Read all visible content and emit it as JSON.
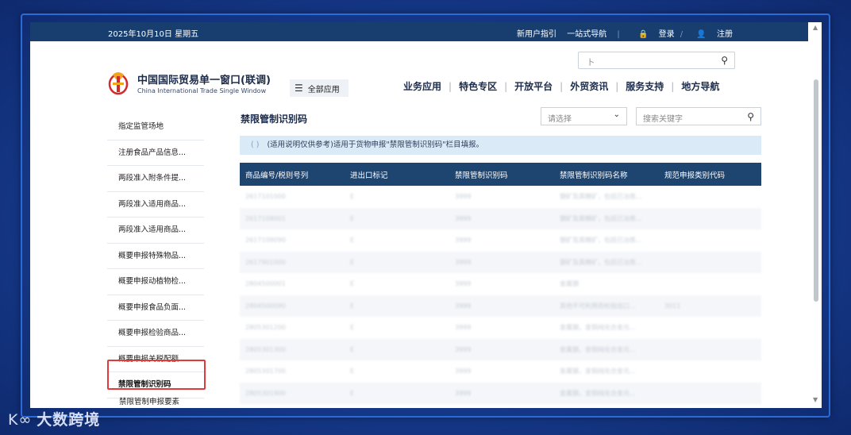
{
  "topbar": {
    "date": "2025年10月10日 星期五",
    "guide": "新用户指引",
    "one_stop": "一站式导航",
    "login": "登录",
    "register": "注册"
  },
  "header": {
    "logo_cn": "中国国际贸易单一窗口(联调)",
    "logo_en": "China International Trade Single Window",
    "all_apps": "全部应用",
    "search_placeholder": "卜",
    "nav": [
      "业务应用",
      "特色专区",
      "开放平台",
      "外贸资讯",
      "服务支持",
      "地方导航"
    ]
  },
  "sidebar": {
    "items": [
      "指定监管场地",
      "注册食品产品信息...",
      "两段准入附条件提...",
      "两段准入适用商品...",
      "两段准入适用商品...",
      "概要申报特殊物品...",
      "概要申报动植物检...",
      "概要申报食品负面...",
      "概要申报检验商品...",
      "概要申报关税配额...",
      "禁限管制识别码"
    ],
    "next_item": "禁限管制申报要素"
  },
  "main": {
    "title": "禁限管制识别码",
    "select_placeholder": "请选择",
    "keyword_placeholder": "搜索关键字",
    "notice": "(适用说明仅供参考)适用于货物申报\"禁限管制识别码\"栏目填报。",
    "table": {
      "headers": [
        "商品编号/税则号列",
        "进出口标记",
        "禁限管制识别码",
        "禁限管制识别码名称",
        "规范申报类别代码"
      ],
      "rows": [
        [
          "2617101000",
          "E",
          "3999",
          "钢矿及其精矿，包括已冶炼...",
          ""
        ],
        [
          "2617109001",
          "E",
          "3999",
          "钢矿及其精矿，包括已冶炼...",
          ""
        ],
        [
          "2617109090",
          "E",
          "3999",
          "钢矿及其精矿，包括已冶炼...",
          ""
        ],
        [
          "2617901000",
          "E",
          "3999",
          "钢矿及其精矿，包括已冶炼...",
          ""
        ],
        [
          "2804500001",
          "E",
          "3999",
          "金属钢",
          ""
        ],
        [
          "2804500090",
          "E",
          "3999",
          "其他不可利用而检验出口...",
          "3011"
        ],
        [
          "2805301200",
          "E",
          "3999",
          "金属钢，金铜纯化合金元...",
          ""
        ],
        [
          "2805301300",
          "E",
          "3999",
          "金属钢，金铜纯化合金元...",
          ""
        ],
        [
          "2805301700",
          "E",
          "3999",
          "金属钢，金铜纯化合金元...",
          ""
        ],
        [
          "2805301900",
          "E",
          "3999",
          "金属钢，金铜纯化合金元...",
          ""
        ]
      ]
    }
  },
  "watermark": "大数跨境"
}
